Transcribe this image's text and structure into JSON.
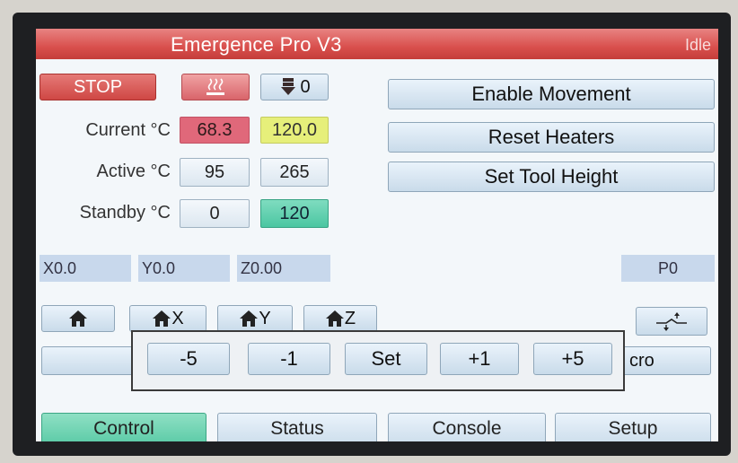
{
  "header": {
    "title": "Emergence Pro V3",
    "state": "Idle"
  },
  "toolbar": {
    "stop_label": "STOP",
    "fan_value": "0"
  },
  "actions": {
    "enable_movement": "Enable Movement",
    "reset_heaters": "Reset Heaters",
    "set_tool_height": "Set Tool Height"
  },
  "temps": {
    "current_label": "Current °C",
    "active_label": "Active °C",
    "standby_label": "Standby °C",
    "bed_current": "68.3",
    "tool_current": "120.0",
    "bed_active": "95",
    "tool_active": "265",
    "bed_standby": "0",
    "tool_standby": "120"
  },
  "position": {
    "x": "X0.0",
    "y": "Y0.0",
    "z": "Z0.00",
    "p": "P0"
  },
  "home": {
    "x_label": "X",
    "y_label": "Y",
    "z_label": "Z"
  },
  "macro": {
    "label": "cro"
  },
  "popup": {
    "buttons": [
      "-5",
      "-1",
      "Set",
      "+1",
      "+5"
    ]
  },
  "tabs": [
    "Control",
    "Status",
    "Console",
    "Setup"
  ],
  "colors": {
    "title_bar": "#d9504d",
    "stop": "#cf4744",
    "current_bed": "#e0687a",
    "current_tool": "#e6ef7a",
    "standby_tool": "#4bc6a2",
    "active_tab": "#55c8a3",
    "coord_bg": "#c8d8ec"
  }
}
